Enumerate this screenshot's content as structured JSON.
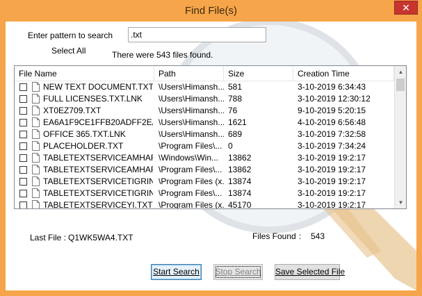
{
  "window": {
    "title": "Find File(s)",
    "close_glyph": "✕",
    "close_icon": "close-icon"
  },
  "search": {
    "pattern_label": "Enter pattern to search",
    "pattern_value": ".txt",
    "select_all_label": "Select All",
    "status_text": "There were 543 files found."
  },
  "table": {
    "columns": [
      "File Name",
      "Path",
      "Size",
      "Creation Time"
    ],
    "rows": [
      {
        "name": "NEW TEXT DOCUMENT.TXT...",
        "path": "\\Users\\Himansh...",
        "size": "581",
        "time": "3-10-2019 6:34:43"
      },
      {
        "name": "FULL LICENSES.TXT.LNK",
        "path": "\\Users\\Himansh...",
        "size": "788",
        "time": "3-10-2019 12:30:12"
      },
      {
        "name": "XT0EZ709.TXT",
        "path": "\\Users\\Himansh...",
        "size": "76",
        "time": "9-10-2019 5:20:15"
      },
      {
        "name": "EA6A1F9CE1FFB20ADFF2EA...",
        "path": "\\Users\\Himansh...",
        "size": "1621",
        "time": "4-10-2019 6:56:48"
      },
      {
        "name": "OFFICE 365.TXT.LNK",
        "path": "\\Users\\Himansh...",
        "size": "689",
        "time": "3-10-2019 7:32:58"
      },
      {
        "name": "PLACEHOLDER.TXT",
        "path": "\\Program Files\\...",
        "size": "0",
        "time": "3-10-2019 7:34:24"
      },
      {
        "name": "TABLETEXTSERVICEAMHAR...",
        "path": "\\Windows\\Win...",
        "size": "13862",
        "time": "3-10-2019 19:2:17"
      },
      {
        "name": "TABLETEXTSERVICEAMHAR...",
        "path": "\\Program Files\\...",
        "size": "13862",
        "time": "3-10-2019 19:2:17"
      },
      {
        "name": "TABLETEXTSERVICETIGRIN...",
        "path": "\\Program Files (x...",
        "size": "13874",
        "time": "3-10-2019 19:2:17"
      },
      {
        "name": "TABLETEXTSERVICETIGRIN...",
        "path": "\\Program Files\\...",
        "size": "13874",
        "time": "3-10-2019 19:2:17"
      },
      {
        "name": "TABLETEXTSERVICEYI.TXT",
        "path": "\\Program Files (x...",
        "size": "45170",
        "time": "3-10-2019 19:2:17"
      }
    ],
    "scroll_up_glyph": "▲",
    "scroll_down_glyph": "▼"
  },
  "summary": {
    "last_file_label": "Last File :",
    "last_file_value": "Q1WK5WA4.TXT",
    "files_found_label": "Files Found",
    "files_found_sep": ":",
    "files_found_value": "543"
  },
  "buttons": {
    "start_search": "Start Search",
    "stop_search": "Stop Search",
    "save_selected": "Save Selected File"
  },
  "colors": {
    "frame": "#f6a54a",
    "close": "#c7352e"
  }
}
